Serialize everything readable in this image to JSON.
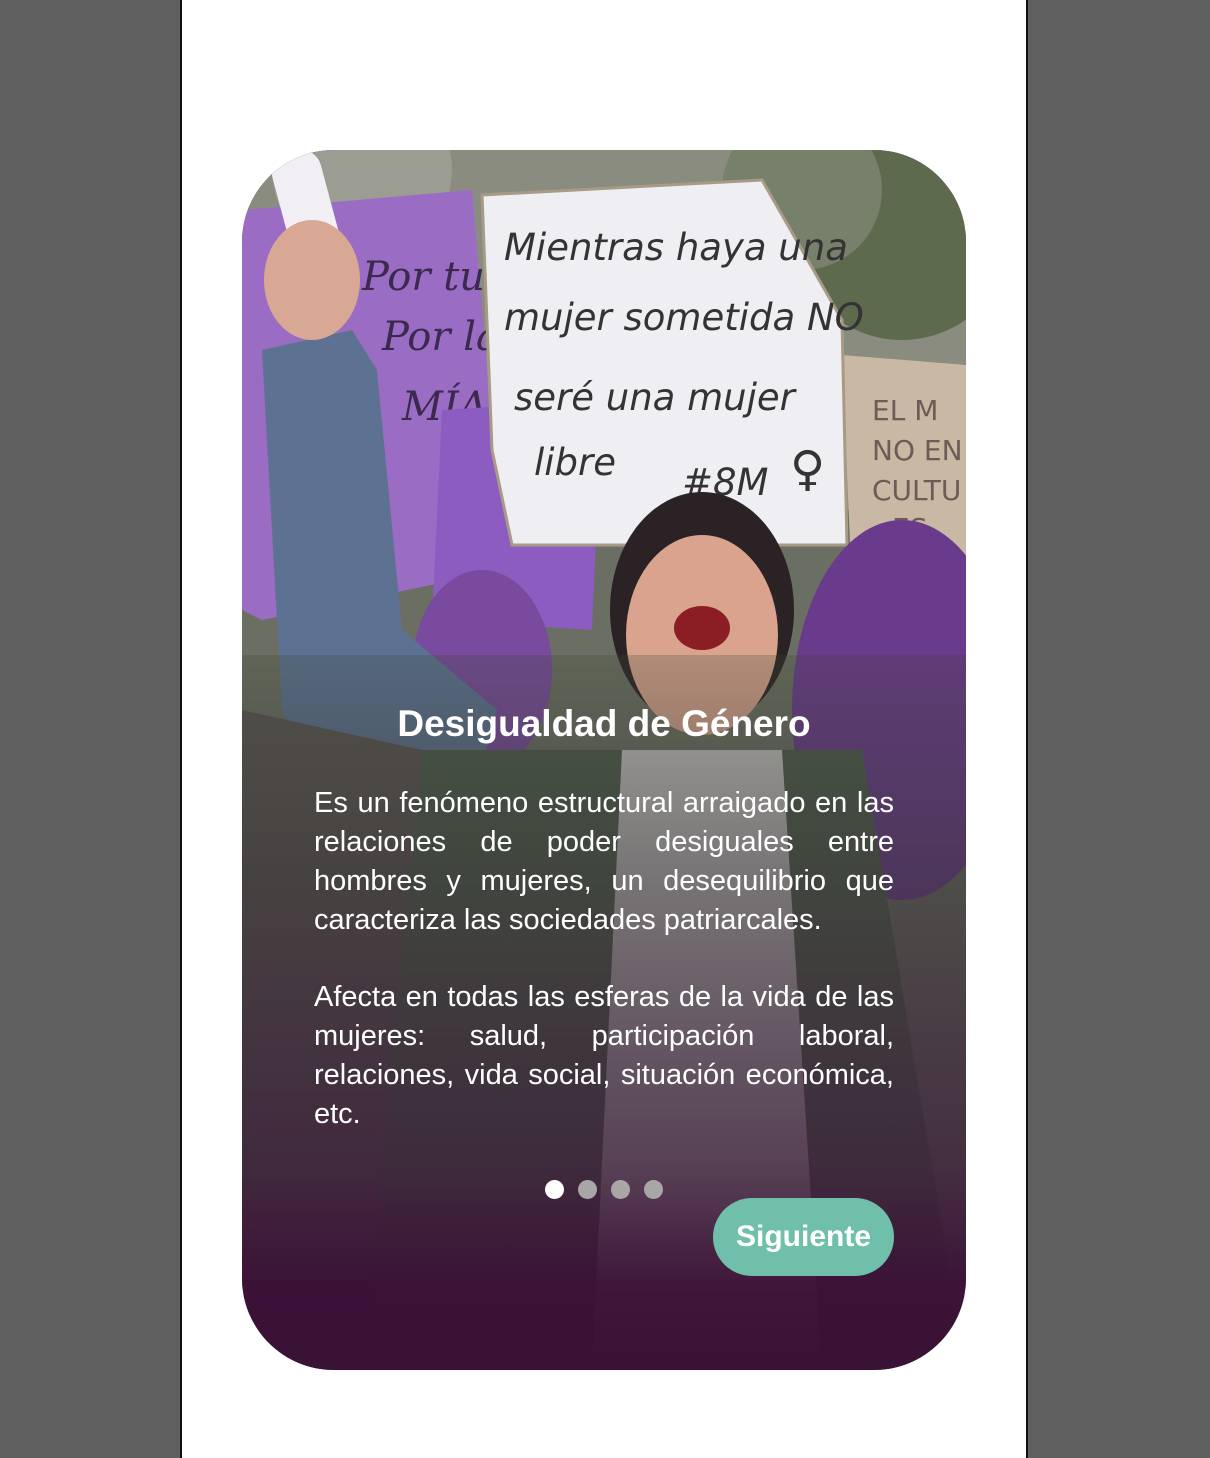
{
  "onboarding": {
    "title": "Desigualdad de Género",
    "paragraph_1": "Es un fenómeno estructural arraigado en las relaciones de poder desiguales entre hombres y mujeres, un desequilibrio que caracteriza las sociedades patriarcales.",
    "paragraph_2": "Afecta en todas las esferas de la vida de las mujeres: salud, participación laboral, relaciones, vida social, situación económica, etc.",
    "photo_description_icon": "protest-photo",
    "sign_text": [
      "Mientras haya una",
      "mujer sometida NO",
      "seré una mujer",
      "libre",
      "#8M"
    ],
    "left_sign_text": [
      "Por tu",
      "Por la",
      "MÍA"
    ],
    "right_sign_text": [
      "EL M",
      "NO EN",
      "CULTU",
      "ES"
    ],
    "pagination": {
      "total": 4,
      "active_index": 0
    },
    "next_label": "Siguiente"
  },
  "colors": {
    "accent": "#6fbfaa",
    "card_bottom": "#3a1236",
    "purple_sign": "#9a6cc4",
    "background": "#606060"
  }
}
